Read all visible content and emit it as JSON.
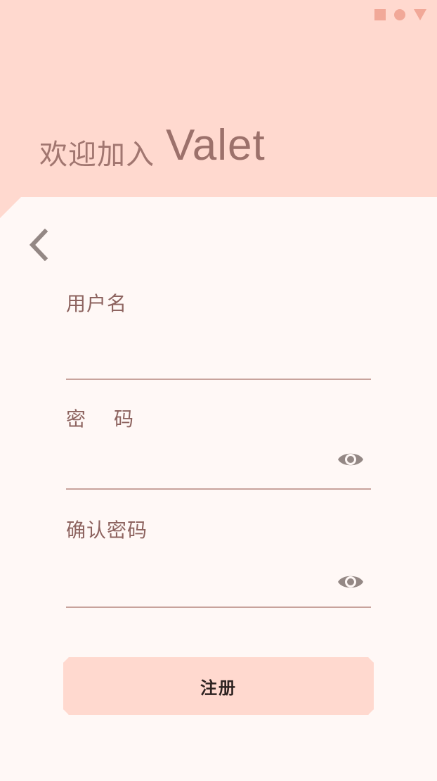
{
  "status_bar": {
    "icons": [
      "square-icon",
      "circle-icon",
      "triangle-icon"
    ]
  },
  "header": {
    "welcome": "欢迎加入",
    "app_name": "Valet"
  },
  "form": {
    "username": {
      "label": "用户名",
      "value": ""
    },
    "password": {
      "label": "密码",
      "value": ""
    },
    "confirm_password": {
      "label": "确认密码",
      "value": ""
    },
    "submit_label": "注册"
  },
  "colors": {
    "header_bg": "#FFD9CF",
    "sheet_bg": "#FFF8F6",
    "accent_text": "#9C716B",
    "underline": "#C8A39C",
    "icon_gray": "#948885"
  }
}
